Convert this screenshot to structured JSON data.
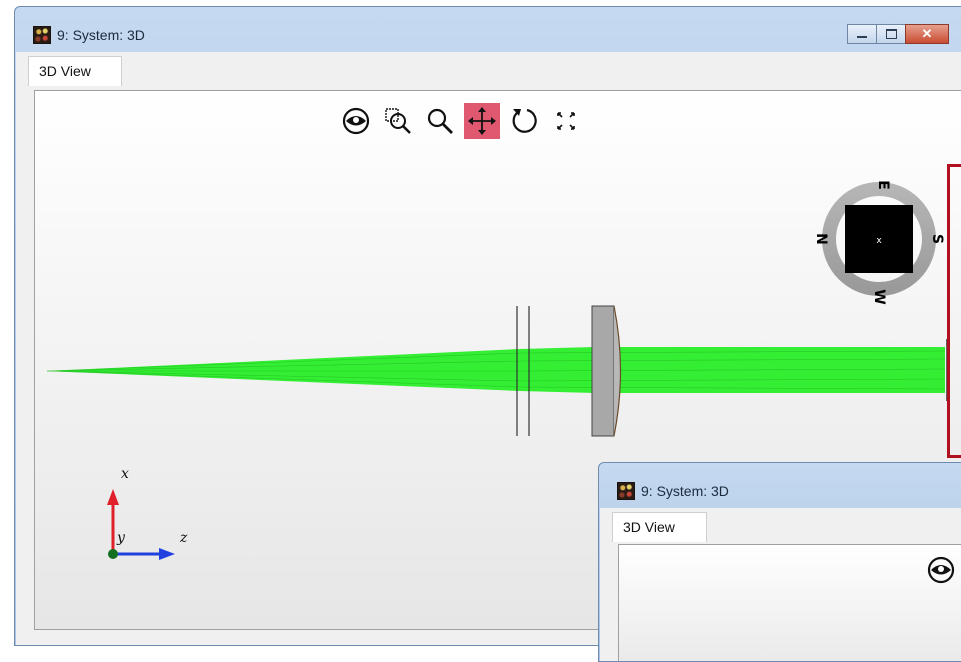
{
  "main_window": {
    "title": "9: System: 3D",
    "tab_label": "3D View",
    "caption_buttons": {
      "minimize_icon": "minimize-icon",
      "maximize_icon": "maximize-icon",
      "close_icon": "close-icon",
      "close_glyph": "✕"
    }
  },
  "toolbar": {
    "items": [
      {
        "name": "eye-icon",
        "active": false
      },
      {
        "name": "zoom-window-icon",
        "active": false
      },
      {
        "name": "zoom-icon",
        "active": false
      },
      {
        "name": "pan-icon",
        "active": true
      },
      {
        "name": "rotate-icon",
        "active": false
      },
      {
        "name": "fit-view-icon",
        "active": false
      }
    ],
    "active_color": "#e05770"
  },
  "compass": {
    "labels": [
      "E",
      "S",
      "W",
      "N"
    ],
    "center_mark": "x"
  },
  "axis_triad": {
    "x_label": "x",
    "y_label": "y",
    "z_label": "z",
    "x_color": "#e0202a",
    "z_color": "#2040e0",
    "y_color": "#107020"
  },
  "ray_color": "#33ee33",
  "sub_window": {
    "title": "9: System: 3D",
    "tab_label": "3D View"
  },
  "highlight_color": "#b0101f"
}
